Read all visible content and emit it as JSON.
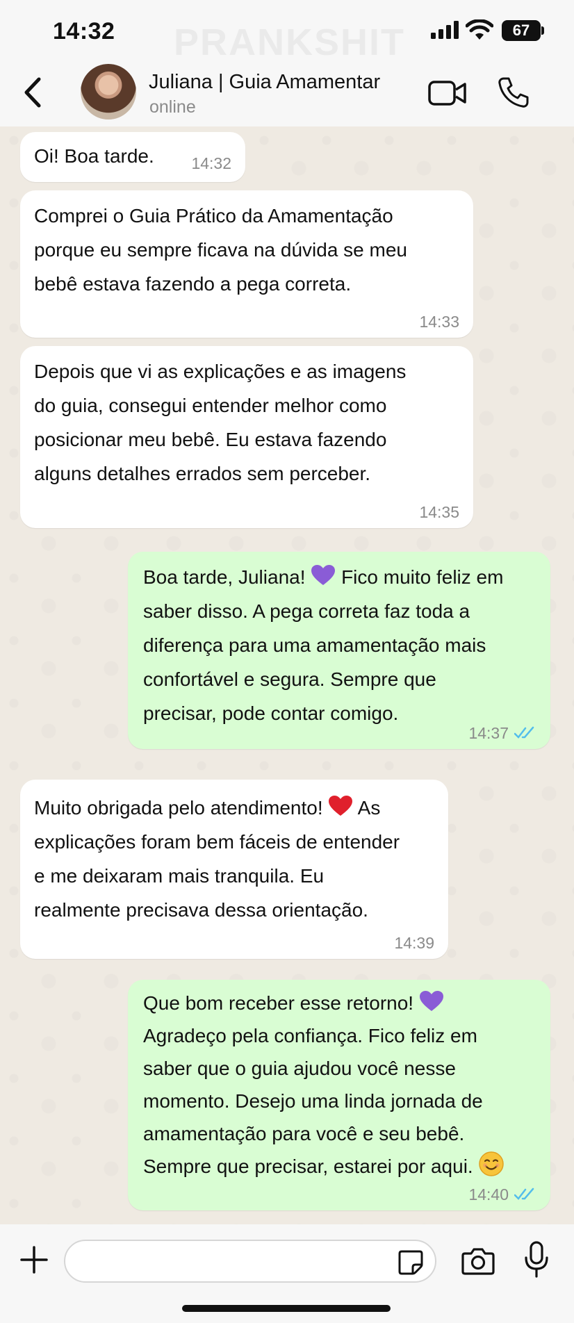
{
  "status_bar": {
    "time": "14:32",
    "watermark": "PRANKSHIT",
    "battery": "67"
  },
  "header": {
    "contact_name": "Juliana | Guia Amamentar",
    "contact_status": "online"
  },
  "messages": [
    {
      "direction": "in",
      "text": "Oi! Boa tarde.",
      "time": "14:32"
    },
    {
      "direction": "in",
      "lines": [
        "Comprei o Guia Prático da Amamentação",
        "porque eu sempre ficava na dúvida se meu",
        "bebê estava fazendo a pega correta."
      ],
      "time": "14:33"
    },
    {
      "direction": "in",
      "lines": [
        "Depois que vi as explicações e as imagens",
        "do guia, consegui entender melhor como",
        "posicionar meu bebê. Eu estava fazendo",
        "alguns detalhes errados sem perceber."
      ],
      "time": "14:35"
    },
    {
      "direction": "out",
      "line1_before": "Boa tarde, Juliana!",
      "line1_after": "Fico muito feliz em",
      "lines": [
        "saber disso. A pega correta faz toda a",
        "diferença para uma amamentação mais",
        "confortável e segura. Sempre que",
        "precisar, pode contar comigo."
      ],
      "emoji": "purple-heart",
      "time": "14:37",
      "status": "read"
    },
    {
      "direction": "in",
      "line1_before": "Muito obrigada pelo atendimento!",
      "line1_after": "As",
      "lines": [
        "explicações foram bem fáceis de entender",
        "e me deixaram mais tranquila. Eu",
        "realmente precisava dessa orientação."
      ],
      "emoji": "red-heart",
      "time": "14:39"
    },
    {
      "direction": "out",
      "line1_before": "Que bom receber esse retorno!",
      "lines": [
        "Agradeço pela confiança. Fico feliz em",
        "saber que o guia ajudou você nesse",
        "momento. Desejo uma linda jornada de",
        "amamentação para você e seu bebê."
      ],
      "last_line": "Sempre que precisar, estarei por aqui.",
      "emoji": "purple-heart",
      "emoji_end": "smiling-face",
      "time": "14:40",
      "status": "read"
    }
  ],
  "colors": {
    "chat_background": "#efeae2",
    "incoming_bubble": "#ffffff",
    "outgoing_bubble": "#d9fdd3",
    "read_ticks": "#53bdeb",
    "purple_heart": "#8a5cd6",
    "red_heart": "#e0202c"
  },
  "input": {
    "placeholder": ""
  }
}
